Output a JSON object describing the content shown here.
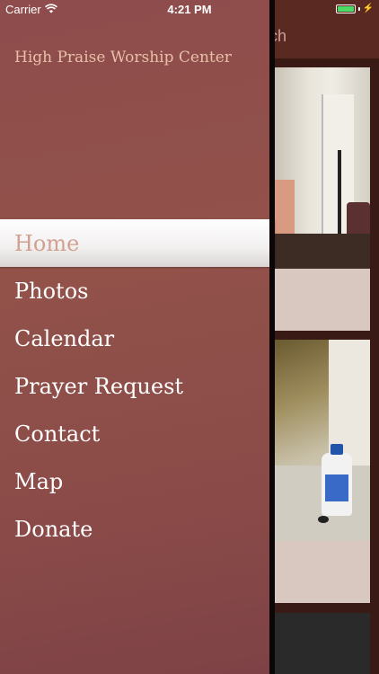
{
  "status_bar": {
    "carrier": "Carrier",
    "time": "4:21 PM",
    "battery_level": 1.0
  },
  "main_view": {
    "nav_title_fragment": "ch"
  },
  "drawer": {
    "church_name": "High Praise Worship Center",
    "menu": [
      {
        "label": "Home",
        "selected": true
      },
      {
        "label": "Photos",
        "selected": false
      },
      {
        "label": "Calendar",
        "selected": false
      },
      {
        "label": "Prayer Request",
        "selected": false
      },
      {
        "label": "Contact",
        "selected": false
      },
      {
        "label": "Map",
        "selected": false
      },
      {
        "label": "Donate",
        "selected": false
      }
    ]
  },
  "colors": {
    "drawer_bg": "#8e4c4c",
    "selected_bg": "#f2efef",
    "selected_text": "#d0a090",
    "church_name_text": "#e8c0a8",
    "battery_green": "#4cd964"
  }
}
